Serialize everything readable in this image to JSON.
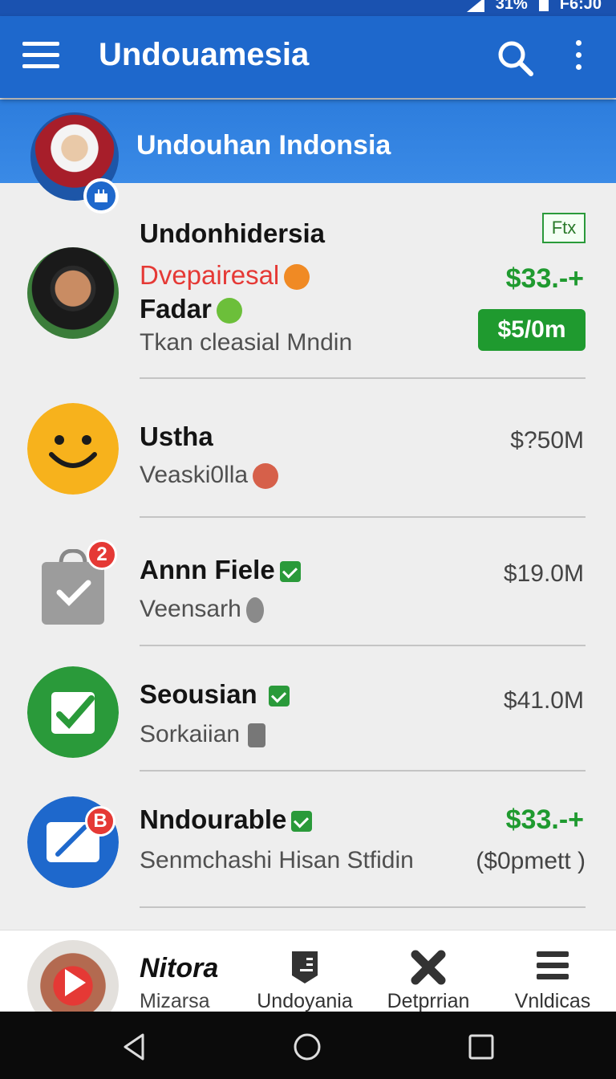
{
  "status_bar": {
    "battery": "31%",
    "time": "F6:J0"
  },
  "app_bar": {
    "title": "Undouamesia"
  },
  "profile": {
    "title": "Undouhan Indonsia"
  },
  "rows": [
    {
      "name": "Undonhidersia",
      "highlight": "Dvepairesal",
      "line2": "Fadar",
      "sub": "Tkan cleasial Mndin",
      "chip": "Ftx",
      "amount": "$33.-+",
      "pill": "$5/0m"
    },
    {
      "name": "Ustha",
      "sub": "Veaski0lla",
      "amount": "$?50M"
    },
    {
      "name": "Annn Fiele",
      "sub": "Veensarh",
      "amount": "$19.0M",
      "badge": "2"
    },
    {
      "name": "Seousian",
      "sub": "Sorkaiian",
      "amount": "$41.0M"
    },
    {
      "name": "Nndourable",
      "sub": "Senmchashi Hisan Stfidin",
      "amount": "$33.-+",
      "amount2": "($0pmett )",
      "badge": "B"
    }
  ],
  "bottom_nav": {
    "current": {
      "title": "Nitora",
      "sub": "Mizarsa"
    },
    "items": [
      {
        "label": "Undoyania",
        "icon": "tag-icon"
      },
      {
        "label": "Detprrian",
        "icon": "close-x-icon"
      },
      {
        "label": "Vnldicas",
        "icon": "menu-icon"
      }
    ]
  },
  "colors": {
    "app_bar": "#1e68cc",
    "accent_green": "#1f9a2f",
    "badge_red": "#e53935",
    "highlight_red": "#e53935"
  }
}
